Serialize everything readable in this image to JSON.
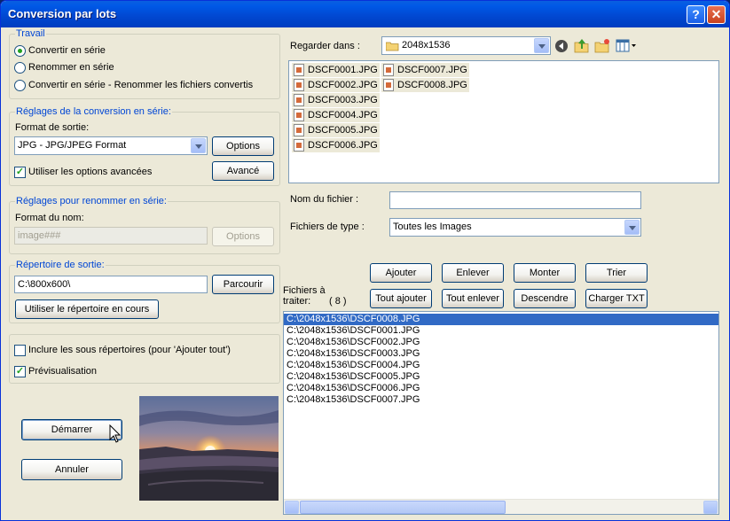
{
  "window": {
    "title": "Conversion par lots",
    "help": "?",
    "close": "✕"
  },
  "travail": {
    "legend": "Travail",
    "options": [
      "Convertir en série",
      "Renommer en série",
      "Convertir en série - Renommer les fichiers convertis"
    ],
    "selected_index": 0
  },
  "conversion": {
    "legend": "Réglages de la conversion en série:",
    "format_label": "Format de sortie:",
    "format_value": "JPG - JPG/JPEG Format",
    "options_button": "Options",
    "advanced_checkbox": "Utiliser les options avancées",
    "advanced_checked": true,
    "advanced_button": "Avancé"
  },
  "rename": {
    "legend": "Réglages pour renommer en série:",
    "name_label": "Format du nom:",
    "name_value": "image###",
    "options_button": "Options"
  },
  "output": {
    "legend": "Répertoire de sortie:",
    "path": "C:\\800x600\\",
    "browse_button": "Parcourir",
    "use_current_button": "Utiliser le répertoire en cours"
  },
  "misc": {
    "include_subdirs": "Inclure les sous répertoires (pour 'Ajouter tout')",
    "include_subdirs_checked": false,
    "preview": "Prévisualisation",
    "preview_checked": true
  },
  "actions": {
    "start": "Démarrer",
    "cancel": "Annuler"
  },
  "browser": {
    "look_in_label": "Regarder dans :",
    "folder": "2048x1536",
    "files_col1": [
      "DSCF0001.JPG",
      "DSCF0002.JPG",
      "DSCF0003.JPG",
      "DSCF0004.JPG",
      "DSCF0005.JPG",
      "DSCF0006.JPG"
    ],
    "files_col2": [
      "DSCF0007.JPG",
      "DSCF0008.JPG"
    ],
    "filename_label": "Nom du fichier :",
    "filename_value": "",
    "filetype_label": "Fichiers de type :",
    "filetype_value": "Toutes les Images"
  },
  "queue_buttons": {
    "add": "Ajouter",
    "remove": "Enlever",
    "up": "Monter",
    "sort": "Trier",
    "add_all": "Tout ajouter",
    "remove_all": "Tout enlever",
    "down": "Descendre",
    "load_txt": "Charger TXT"
  },
  "queue": {
    "label_line1": "Fichiers à",
    "label_line2": "traiter:",
    "count": "( 8 )",
    "items": [
      "C:\\2048x1536\\DSCF0008.JPG",
      "C:\\2048x1536\\DSCF0001.JPG",
      "C:\\2048x1536\\DSCF0002.JPG",
      "C:\\2048x1536\\DSCF0003.JPG",
      "C:\\2048x1536\\DSCF0004.JPG",
      "C:\\2048x1536\\DSCF0005.JPG",
      "C:\\2048x1536\\DSCF0006.JPG",
      "C:\\2048x1536\\DSCF0007.JPG"
    ],
    "selected_index": 0
  },
  "icons": [
    "folder-icon",
    "back-icon",
    "up-folder-icon",
    "new-folder-icon",
    "view-menu-icon",
    "mouse-cursor-icon",
    "image-file-icon"
  ],
  "colors": {
    "title_bar": "#0054e3",
    "group_legend": "#0046d5",
    "selection": "#316ac5",
    "check": "#21a121"
  }
}
